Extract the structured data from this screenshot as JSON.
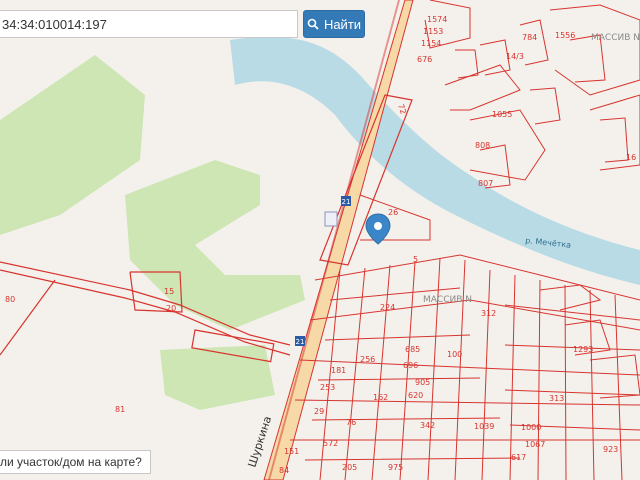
{
  "search": {
    "query": "34:34:010014:197",
    "button_label": "Найти",
    "button_icon": "search-icon"
  },
  "map": {
    "river_label": "р. Мечётка",
    "street_label": "Шуркина",
    "massiv_labels": [
      "МАССИВ N",
      "МАССИВ N"
    ],
    "road_label": "72",
    "marker_icon": "location-pin-icon",
    "parcel_labels": [
      "1574",
      "1153",
      "1154",
      "676",
      "14/3",
      "784",
      "1556",
      "1055",
      "808",
      "807",
      "26",
      "80",
      "20",
      "15",
      "81",
      "224",
      "312",
      "256",
      "685",
      "696",
      "100",
      "181",
      "253",
      "620",
      "342",
      "905",
      "313",
      "923",
      "1293",
      "1039",
      "162",
      "76",
      "29",
      "151",
      "572",
      "84",
      "205",
      "975",
      "617",
      "1000",
      "1067",
      "5",
      "16"
    ],
    "road_markers": [
      "21",
      "21"
    ],
    "colors": {
      "water": "#b9dbe6",
      "greenery": "#cde6b4",
      "background": "#f4f1ec",
      "road": "#f6d9a6",
      "parcel_border": "#d8342f",
      "accent": "#337ab7"
    }
  },
  "bottom_prompt": "ли участок/дом на карте?"
}
